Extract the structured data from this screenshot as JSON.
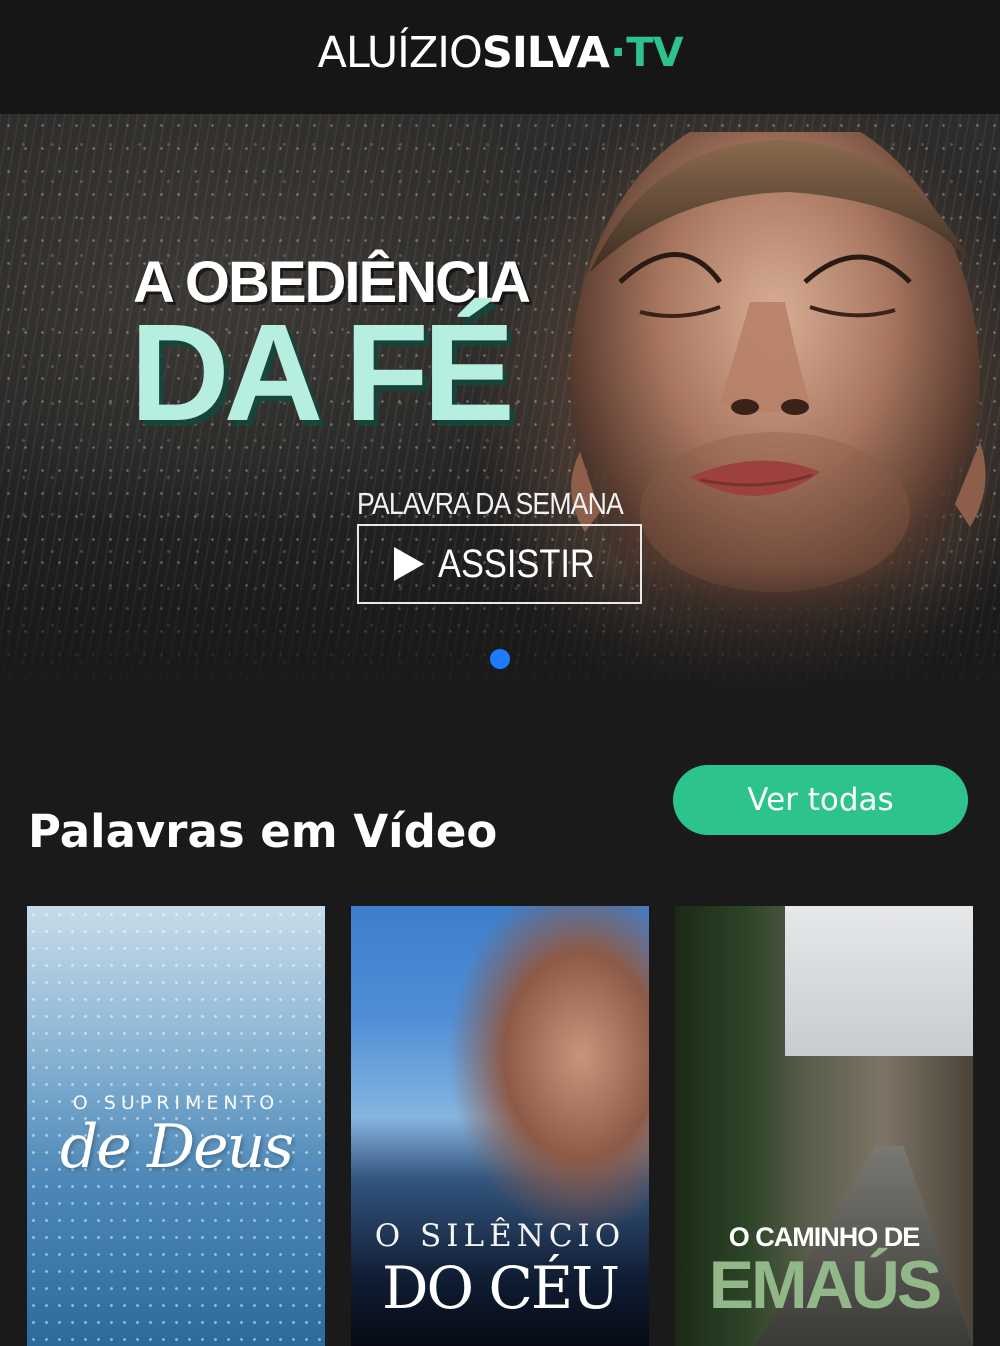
{
  "header": {
    "logo_main": "ALUÍZIO",
    "logo_bold": "SILVA",
    "logo_dot": "·",
    "logo_tv": "TV"
  },
  "hero": {
    "title_line1": "A OBEDIÊNCIA",
    "title_line2": "DA FÉ",
    "subtitle": "PALAVRA DA SEMANA",
    "button_label": "ASSISTIR",
    "slide_count": 1,
    "active_slide": 1
  },
  "section": {
    "title": "Palavras em Vídeo",
    "see_all_label": "Ver todas"
  },
  "cards": [
    {
      "line1": "O SUPRIMENTO",
      "line2": "de Deus"
    },
    {
      "line1": "O SILÊNCIO",
      "line2": "DO CÉU"
    },
    {
      "line1": "O CAMINHO DE",
      "line2": "EMAÚS"
    }
  ],
  "colors": {
    "accent": "#2cc38d",
    "background": "#1a1a1a",
    "header_bg": "#161616",
    "carousel_dot": "#1f7bff",
    "hero_title_accent": "#b6eee0",
    "card3_title_accent": "#92b88a"
  }
}
